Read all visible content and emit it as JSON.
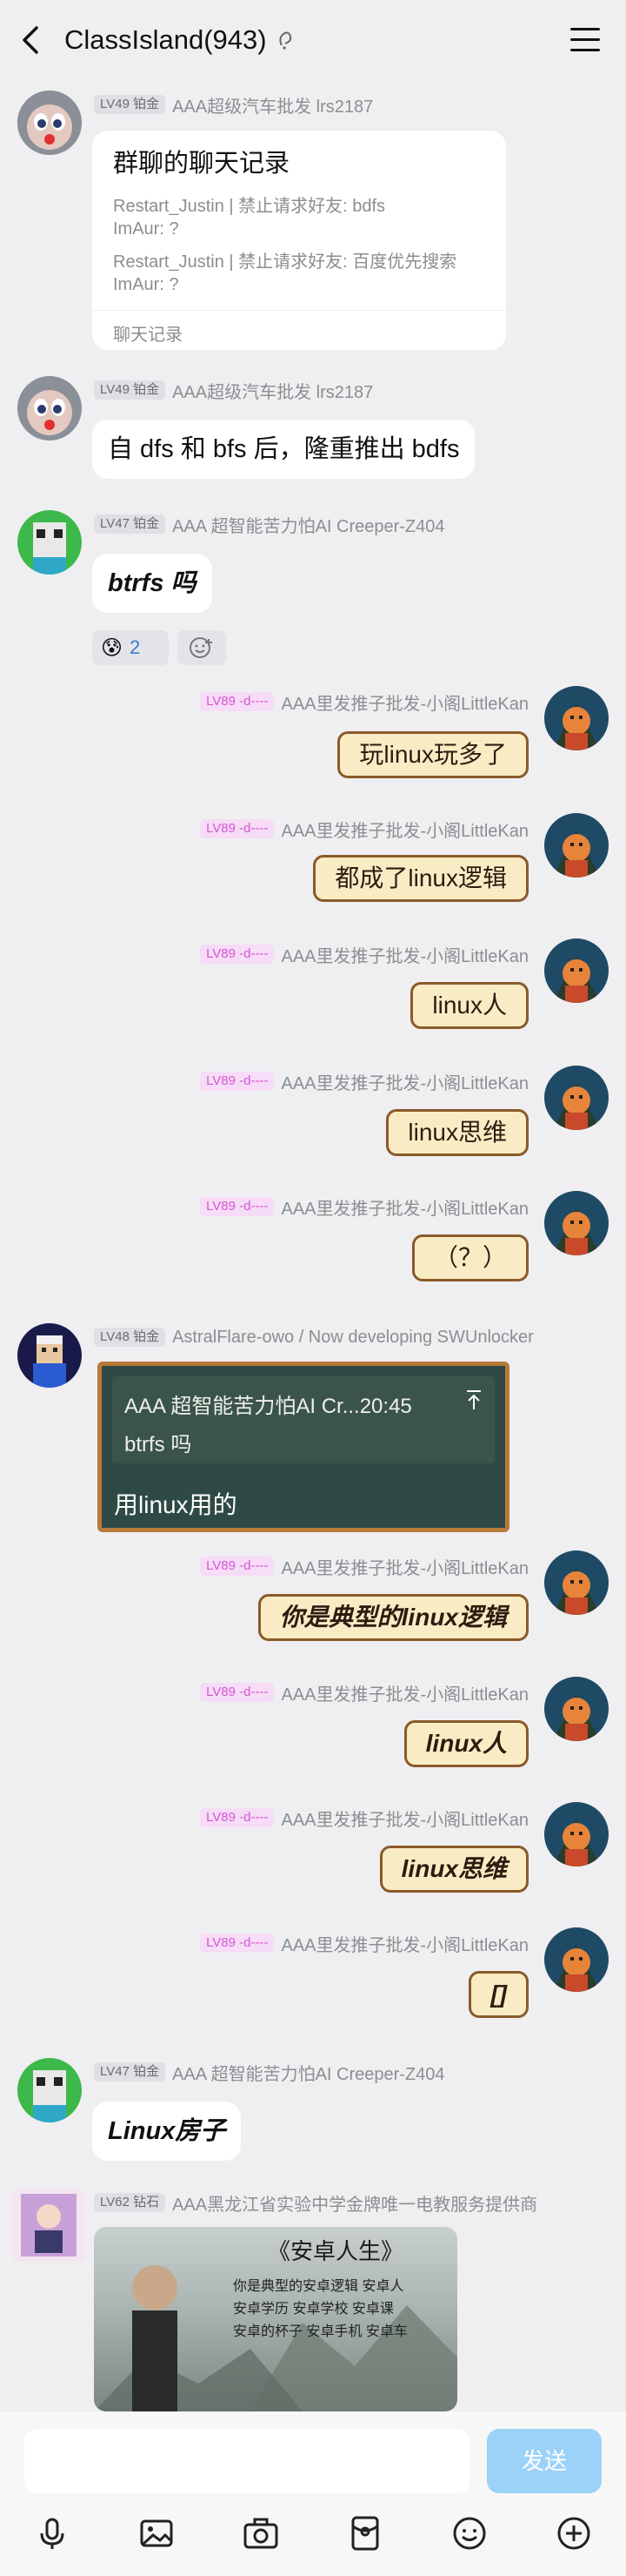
{
  "header": {
    "title": "ClassIsland(943)",
    "title_icon": "mention-icon"
  },
  "msg1": {
    "level": "LV49 铂金",
    "sender": "AAA超级汽车批发 lrs2187",
    "card": {
      "title": "群聊的聊天记录",
      "lines": [
        "Restart_Justin | 禁止请求好友: bdfs",
        "ImAur: ?",
        "Restart_Justin | 禁止请求好友: 百度优先搜索",
        "ImAur: ?"
      ],
      "footer": "聊天记录"
    }
  },
  "msg2": {
    "level": "LV49 铂金",
    "sender": "AAA超级汽车批发 lrs2187",
    "text": "自 dfs 和 bfs 后，隆重推出 bdfs"
  },
  "msg3": {
    "level": "LV47 铂金",
    "sender": "AAA 超智能苦力怕AI Creeper-Z404",
    "text": "btrfs 吗",
    "reaction": "😰",
    "reaction_count": "2"
  },
  "right_msgs": [
    {
      "level": "LV89 -d----",
      "sender": "AAA里发推子批发-小阁LittleKan",
      "text": "玩linux玩多了"
    },
    {
      "level": "LV89 -d----",
      "sender": "AAA里发推子批发-小阁LittleKan",
      "text": "都成了linux逻辑"
    },
    {
      "level": "LV89 -d----",
      "sender": "AAA里发推子批发-小阁LittleKan",
      "text": "linux人"
    },
    {
      "level": "LV89 -d----",
      "sender": "AAA里发推子批发-小阁LittleKan",
      "text": "linux思维"
    },
    {
      "level": "LV89 -d----",
      "sender": "AAA里发推子批发-小阁LittleKan",
      "text": "（？）"
    }
  ],
  "msg9": {
    "level": "LV48 铂金",
    "sender": "AstralFlare-owo / Now developing SWUnlocker",
    "quote_header": "AAA 超智能苦力怕AI Cr...20:45",
    "quote_text": "btrfs 吗",
    "text": "用linux用的"
  },
  "right_msgs2": [
    {
      "level": "LV89 -d----",
      "sender": "AAA里发推子批发-小阁LittleKan",
      "text": "你是典型的linux逻辑"
    },
    {
      "level": "LV89 -d----",
      "sender": "AAA里发推子批发-小阁LittleKan",
      "text": "linux人"
    },
    {
      "level": "LV89 -d----",
      "sender": "AAA里发推子批发-小阁LittleKan",
      "text": "linux思维"
    },
    {
      "level": "LV89 -d----",
      "sender": "AAA里发推子批发-小阁LittleKan",
      "text": "[]"
    }
  ],
  "msg14": {
    "level": "LV47 铂金",
    "sender": "AAA 超智能苦力怕AI Creeper-Z404",
    "text": "Linux房子"
  },
  "msg15": {
    "level": "LV62 钻石",
    "sender": "AAA黑龙江省实验中学金牌唯一电教服务提供商",
    "image_title": "《安卓人生》",
    "image_lines": [
      "你是典型的安卓逻辑 安卓人",
      "安卓学历 安卓学校 安卓课",
      "安卓的杯子 安卓手机 安卓车"
    ]
  },
  "composer": {
    "send_label": "发送"
  },
  "toolbar": [
    "mic-icon",
    "image-icon",
    "camera-icon",
    "red-packet-icon",
    "emoji-icon",
    "plus-icon"
  ]
}
